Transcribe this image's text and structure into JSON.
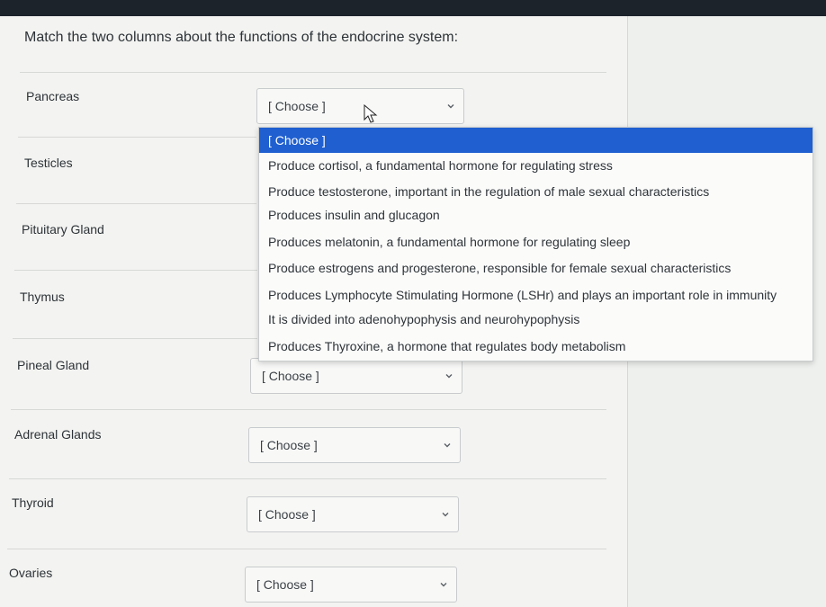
{
  "question": {
    "text": "Match the two columns about the functions of the endocrine system:"
  },
  "rows": [
    {
      "label": "Pancreas",
      "value": "[ Choose ]"
    },
    {
      "label": "Testicles",
      "value": ""
    },
    {
      "label": "Pituitary Gland",
      "value": ""
    },
    {
      "label": "Thymus",
      "value": ""
    },
    {
      "label": "Pineal Gland",
      "value": "[ Choose ]"
    },
    {
      "label": "Adrenal Glands",
      "value": "[ Choose ]"
    },
    {
      "label": "Thyroid",
      "value": "[ Choose ]"
    },
    {
      "label": "Ovaries",
      "value": "[ Choose ]"
    }
  ],
  "dropdown": {
    "options": [
      "[ Choose ]",
      "Produce cortisol, a fundamental hormone for regulating stress",
      "Produce testosterone, important in the regulation of male sexual characteristics",
      "Produces insulin and glucagon",
      "Produces melatonin, a fundamental hormone for regulating sleep",
      "Produce estrogens and progesterone, responsible for female sexual characteristics",
      "Produces Lymphocyte Stimulating Hormone (LSHr) and plays an important role in immunity",
      "It is divided into adenohypophysis and neurohypophysis",
      "Produces Thyroxine, a hormone that regulates body metabolism"
    ],
    "selected_index": 0
  },
  "colors": {
    "highlight": "#1f5fd0",
    "page_background": "#f3f3f1",
    "top_bar": "#1d232b"
  },
  "icons": {
    "dropdown_arrow": "chevron-down-icon",
    "cursor": "mouse-pointer-icon"
  }
}
